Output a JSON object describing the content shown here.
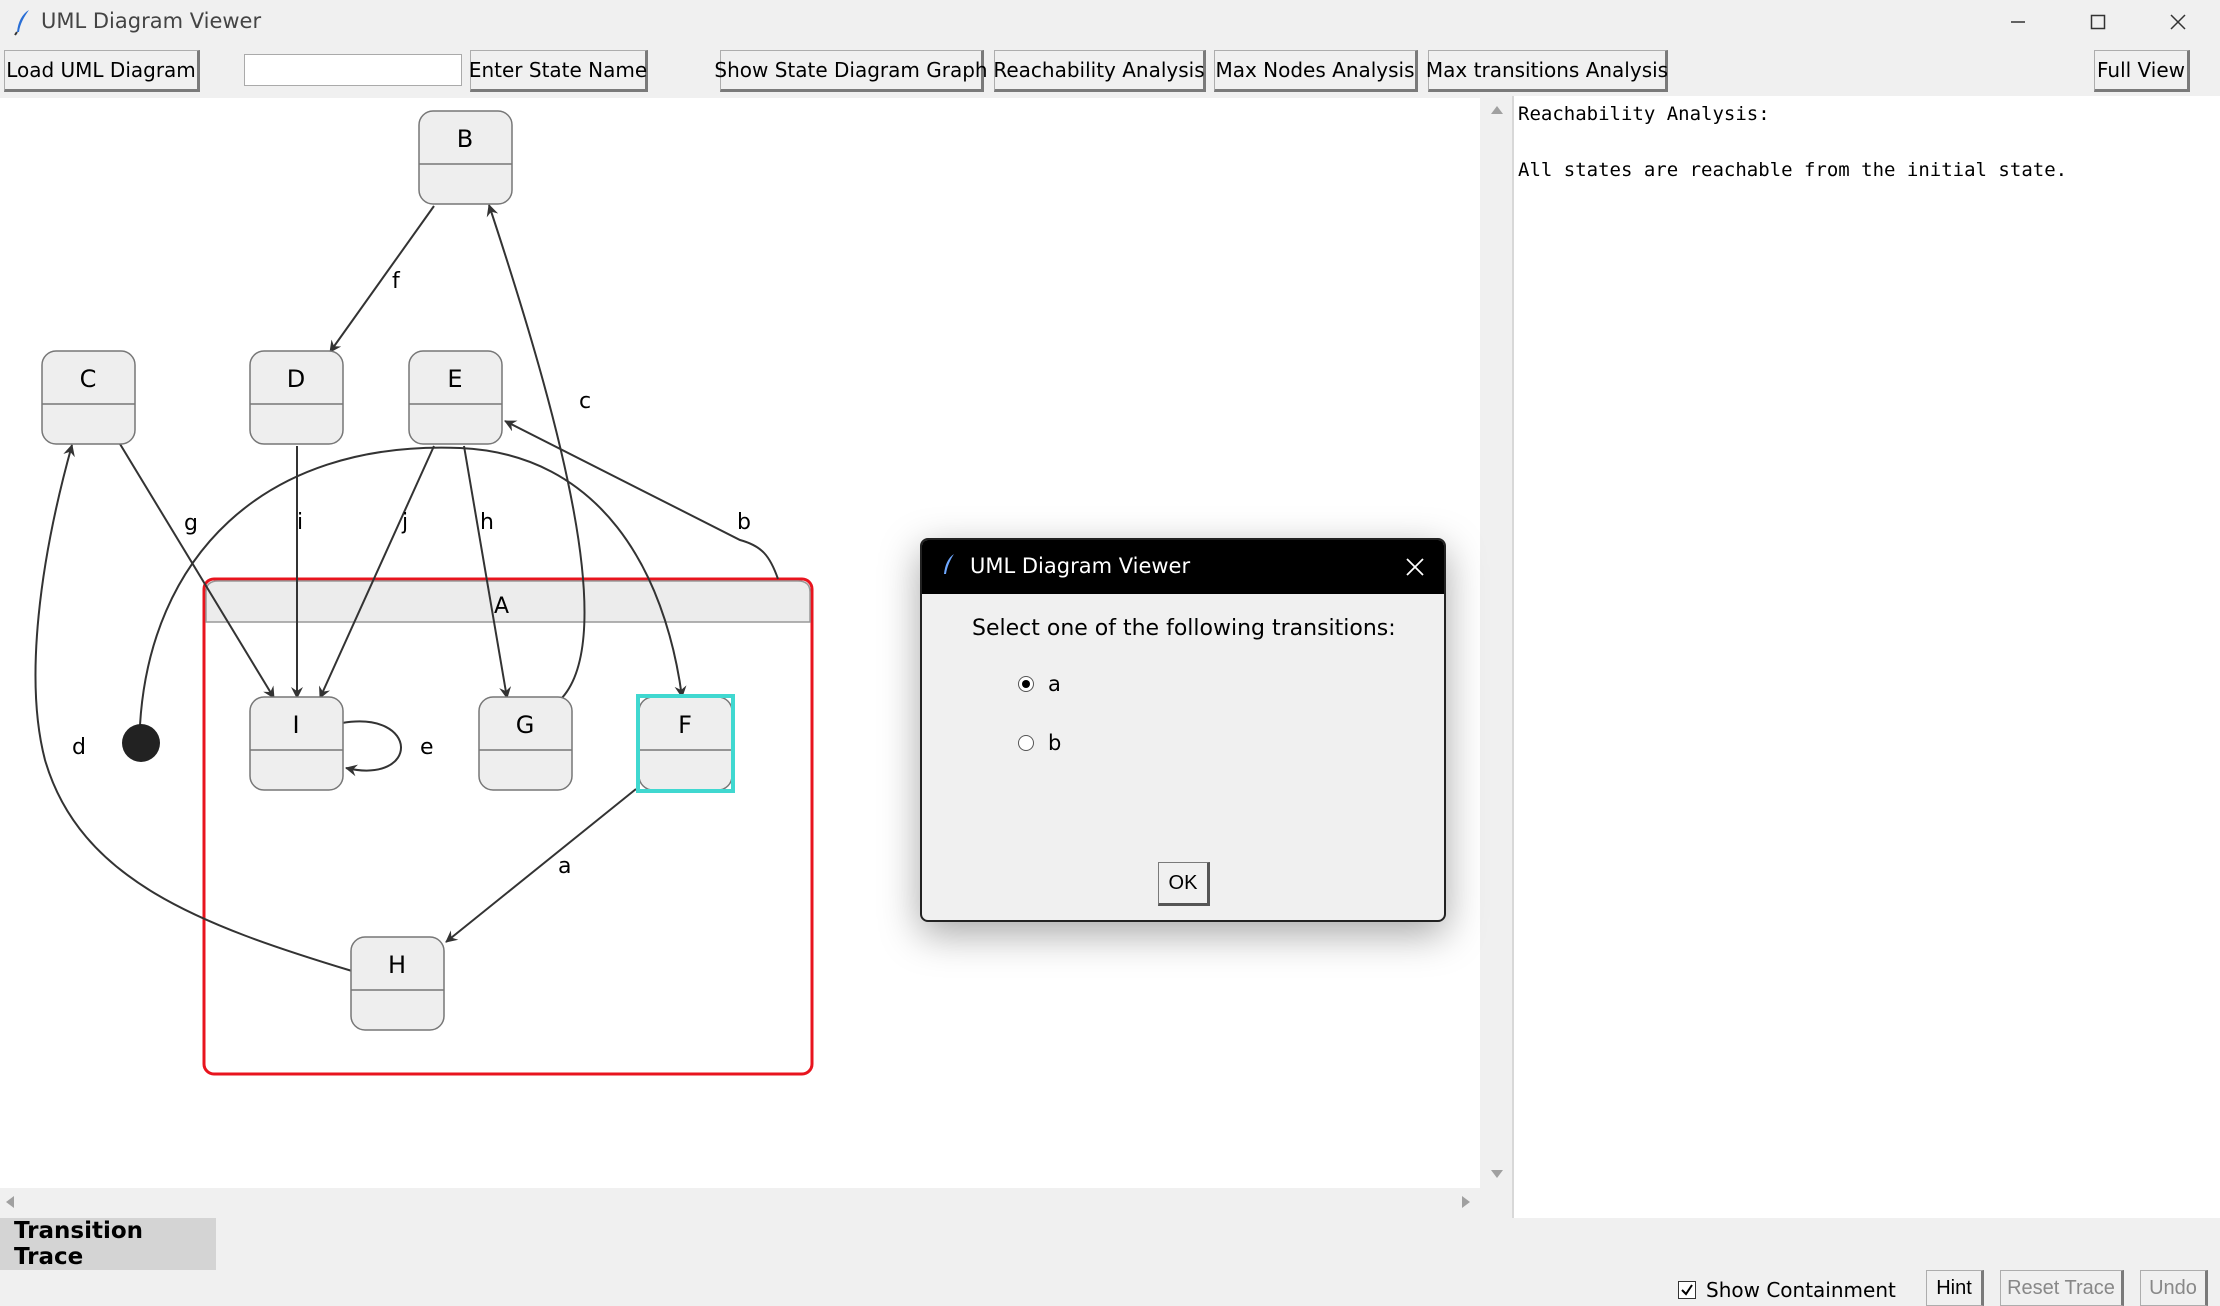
{
  "window": {
    "title": "UML Diagram Viewer",
    "controls": [
      "minimize",
      "maximize",
      "close"
    ]
  },
  "toolbar": {
    "load_label": "Load UML Diagram",
    "state_input_value": "",
    "enter_state_label": "Enter State Name",
    "show_graph_label": "Show State Diagram Graph",
    "reachability_label": "Reachability Analysis",
    "max_nodes_label": "Max Nodes Analysis",
    "max_transitions_label": "Max transitions Analysis",
    "full_view_label": "Full View"
  },
  "diagram": {
    "composite": {
      "name": "A",
      "border_color": "#e8141e"
    },
    "highlight_color": "#40d8d0",
    "states": {
      "B": "B",
      "C": "C",
      "D": "D",
      "E": "E",
      "I": "I",
      "G": "G",
      "F": "F",
      "H": "H"
    },
    "transitions": {
      "f": "f",
      "c": "c",
      "g": "g",
      "i": "i",
      "j": "j",
      "h": "h",
      "b": "b",
      "d": "d",
      "e": "e",
      "a": "a"
    }
  },
  "output": {
    "heading": "Reachability Analysis:",
    "message": "All states are reachable from the initial state."
  },
  "trace": {
    "label": "Transition Trace"
  },
  "bottom": {
    "show_containment_label": "Show Containment",
    "show_containment_checked": true,
    "hint_label": "Hint",
    "reset_trace_label": "Reset Trace",
    "undo_label": "Undo"
  },
  "dialog": {
    "title": "UML Diagram Viewer",
    "prompt": "Select one of the following transitions:",
    "options": [
      {
        "label": "a",
        "selected": true
      },
      {
        "label": "b",
        "selected": false
      }
    ],
    "ok_label": "OK"
  }
}
